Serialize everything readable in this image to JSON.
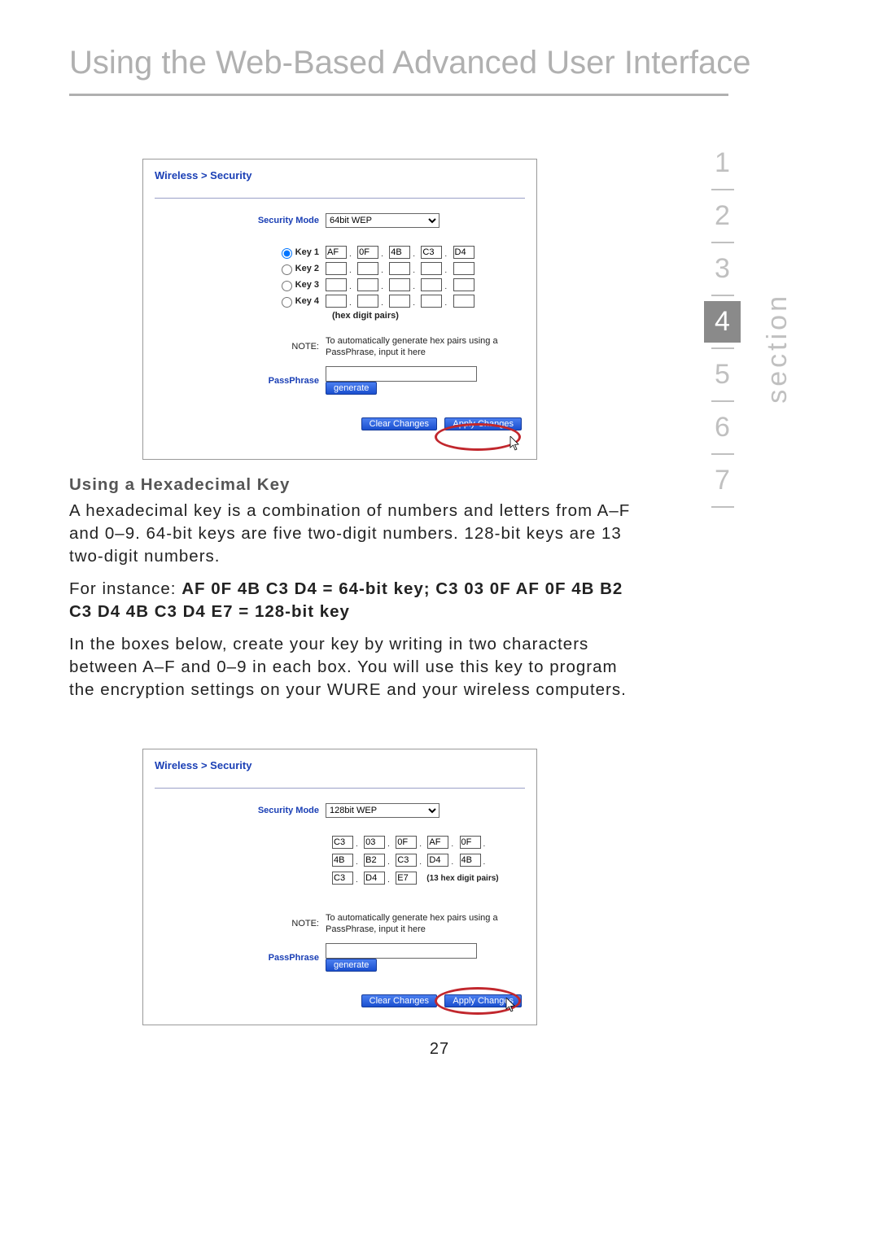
{
  "page_title": "Using the Web-Based Advanced User Interface",
  "side_label": "section",
  "side_tabs": [
    "1",
    "2",
    "3",
    "4",
    "5",
    "6",
    "7"
  ],
  "side_active_index": 3,
  "page_number": "27",
  "narrative": {
    "subhead": "Using a Hexadecimal Key",
    "p1": "A hexadecimal key is a combination of numbers and letters from A–F and 0–9. 64-bit keys are five two-digit numbers. 128-bit keys are 13 two-digit numbers.",
    "p2a": "For instance: ",
    "p2b": "AF 0F 4B C3 D4 = 64-bit key; C3 03 0F AF 0F 4B B2 C3 D4 4B C3 D4 E7 = 128-bit key",
    "p3": "In the boxes below, create your key by writing in two characters between A–F and 0–9 in each box. You will use this key to program the encryption settings on your WURE and your wireless computers."
  },
  "labels": {
    "breadcrumb": "Wireless > Security",
    "security_mode": "Security Mode",
    "note_lbl": "NOTE:",
    "passphrase_lbl": "PassPhrase",
    "note_text": "To automatically generate hex pairs using a PassPhrase, input it here",
    "hex_digit_pairs": "(hex digit pairs)",
    "hex_digit_pairs_13": "(13 hex digit pairs)",
    "generate": "generate",
    "clear_changes": "Clear Changes",
    "apply_changes": "Apply Changes",
    "key1": "Key 1",
    "key2": "Key 2",
    "key3": "Key 3",
    "key4": "Key 4"
  },
  "shot1": {
    "security_mode_value": "64bit WEP",
    "keys": {
      "key1": [
        "AF",
        "0F",
        "4B",
        "C3",
        "D4"
      ],
      "key2": [
        "",
        "",
        "",
        "",
        ""
      ],
      "key3": [
        "",
        "",
        "",
        "",
        ""
      ],
      "key4": [
        "",
        "",
        "",
        "",
        ""
      ]
    },
    "selected_key": "key1",
    "passphrase_value": ""
  },
  "shot2": {
    "security_mode_value": "128bit WEP",
    "pairs": [
      "C3",
      "03",
      "0F",
      "AF",
      "0F",
      "4B",
      "B2",
      "C3",
      "D4",
      "4B",
      "C3",
      "D4",
      "E7"
    ],
    "passphrase_value": ""
  }
}
